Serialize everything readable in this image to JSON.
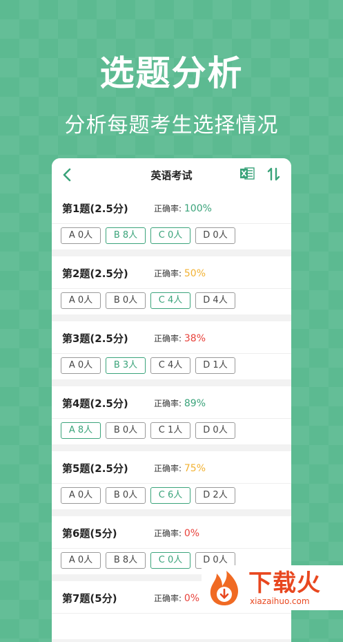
{
  "hero": {
    "title": "选题分析",
    "subtitle": "分析每题考生选择情况"
  },
  "nav": {
    "title": "英语考试",
    "back_icon": "chevron-left-icon",
    "excel_icon": "excel-export-icon",
    "sort_icon": "sort-icon"
  },
  "rate_label": "正确率:",
  "colors": {
    "accent": "#3aa37a",
    "high": "#3aa37a",
    "mid": "#f2b233",
    "low": "#e8423b"
  },
  "questions": [
    {
      "title": "第1题(2.5分)",
      "rate": "100%",
      "level": "high",
      "options": [
        {
          "label": "A 0人",
          "correct": false
        },
        {
          "label": "B 8人",
          "correct": true
        },
        {
          "label": "C 0人",
          "correct": true
        },
        {
          "label": "D 0人",
          "correct": false
        }
      ]
    },
    {
      "title": "第2题(2.5分)",
      "rate": "50%",
      "level": "mid",
      "options": [
        {
          "label": "A 0人",
          "correct": false
        },
        {
          "label": "B 0人",
          "correct": false
        },
        {
          "label": "C 4人",
          "correct": true
        },
        {
          "label": "D 4人",
          "correct": false
        }
      ]
    },
    {
      "title": "第3题(2.5分)",
      "rate": "38%",
      "level": "low",
      "options": [
        {
          "label": "A 0人",
          "correct": false
        },
        {
          "label": "B 3人",
          "correct": true
        },
        {
          "label": "C 4人",
          "correct": false
        },
        {
          "label": "D 1人",
          "correct": false
        }
      ]
    },
    {
      "title": "第4题(2.5分)",
      "rate": "89%",
      "level": "high",
      "options": [
        {
          "label": "A 8人",
          "correct": true
        },
        {
          "label": "B 0人",
          "correct": false
        },
        {
          "label": "C 1人",
          "correct": false
        },
        {
          "label": "D 0人",
          "correct": false
        }
      ]
    },
    {
      "title": "第5题(2.5分)",
      "rate": "75%",
      "level": "mid",
      "options": [
        {
          "label": "A 0人",
          "correct": false
        },
        {
          "label": "B 0人",
          "correct": false
        },
        {
          "label": "C 6人",
          "correct": true
        },
        {
          "label": "D 2人",
          "correct": false
        }
      ]
    },
    {
      "title": "第6题(5分)",
      "rate": "0%",
      "level": "low",
      "options": [
        {
          "label": "A 0人",
          "correct": false
        },
        {
          "label": "B 8人",
          "correct": false
        },
        {
          "label": "C 0人",
          "correct": true
        },
        {
          "label": "D 0人",
          "correct": false
        }
      ]
    },
    {
      "title": "第7题(5分)",
      "rate": "0%",
      "level": "low",
      "options": []
    }
  ],
  "watermark": {
    "brand": "下载火",
    "url": "xiazaihuo.com"
  }
}
